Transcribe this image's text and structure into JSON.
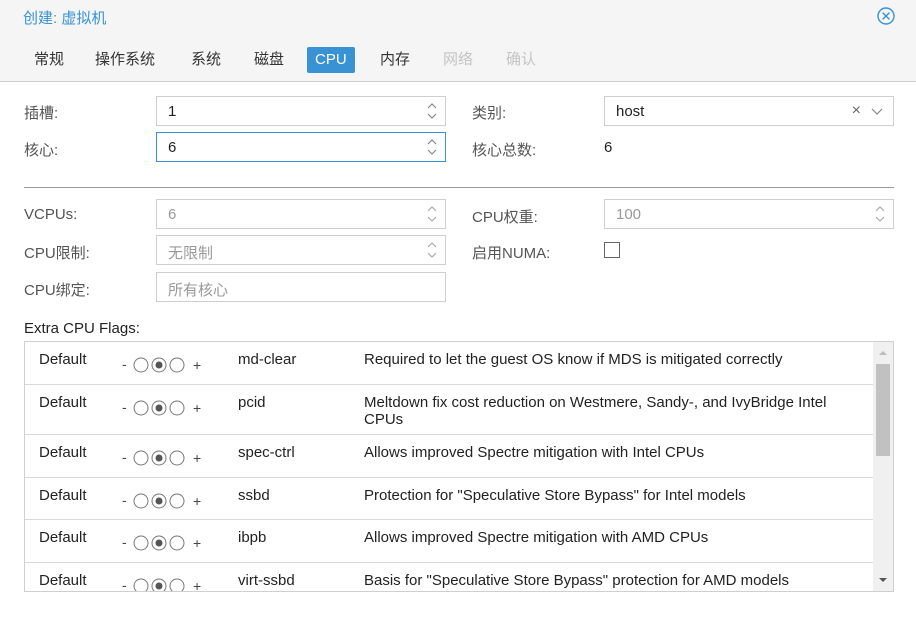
{
  "window": {
    "title": "创建: 虚拟机",
    "close_icon": "close-circle-icon"
  },
  "tabs": [
    {
      "label": "常规",
      "state": "normal"
    },
    {
      "label": "操作系统",
      "state": "normal"
    },
    {
      "label": "系统",
      "state": "normal"
    },
    {
      "label": "磁盘",
      "state": "normal"
    },
    {
      "label": "CPU",
      "state": "active"
    },
    {
      "label": "内存",
      "state": "normal"
    },
    {
      "label": "网络",
      "state": "disabled"
    },
    {
      "label": "确认",
      "state": "disabled"
    }
  ],
  "form": {
    "sockets": {
      "label": "插槽:",
      "value": "1"
    },
    "cores": {
      "label": "核心:",
      "value": "6"
    },
    "type": {
      "label": "类别:",
      "value": "host"
    },
    "total_cores": {
      "label": "核心总数:",
      "value": "6"
    },
    "vcpus": {
      "label": "VCPUs:",
      "value": "6"
    },
    "cpu_limit": {
      "label": "CPU限制:",
      "value": "无限制"
    },
    "cpu_affinity": {
      "label": "CPU绑定:",
      "placeholder": "所有核心"
    },
    "cpu_units": {
      "label": "CPU权重:",
      "value": "100"
    },
    "numa": {
      "label": "启用NUMA:",
      "checked": false
    }
  },
  "flags": {
    "title": "Extra CPU Flags:",
    "rows": [
      {
        "state": "Default",
        "minus": "-",
        "plus": "+",
        "name": "md-clear",
        "desc": "Required to let the guest OS know if MDS is mitigated correctly"
      },
      {
        "state": "Default",
        "minus": "-",
        "plus": "+",
        "name": "pcid",
        "desc": "Meltdown fix cost reduction on Westmere, Sandy-, and IvyBridge Intel CPUs"
      },
      {
        "state": "Default",
        "minus": "-",
        "plus": "+",
        "name": "spec-ctrl",
        "desc": "Allows improved Spectre mitigation with Intel CPUs"
      },
      {
        "state": "Default",
        "minus": "-",
        "plus": "+",
        "name": "ssbd",
        "desc": "Protection for \"Speculative Store Bypass\" for Intel models"
      },
      {
        "state": "Default",
        "minus": "-",
        "plus": "+",
        "name": "ibpb",
        "desc": "Allows improved Spectre mitigation with AMD CPUs"
      },
      {
        "state": "Default",
        "minus": "-",
        "plus": "+",
        "name": "virt-ssbd",
        "desc": "Basis for \"Speculative Store Bypass\" protection for AMD models"
      }
    ]
  },
  "colors": {
    "accent": "#3892d4",
    "header_bg": "#f5f5f5",
    "border": "#cfcfcf"
  }
}
